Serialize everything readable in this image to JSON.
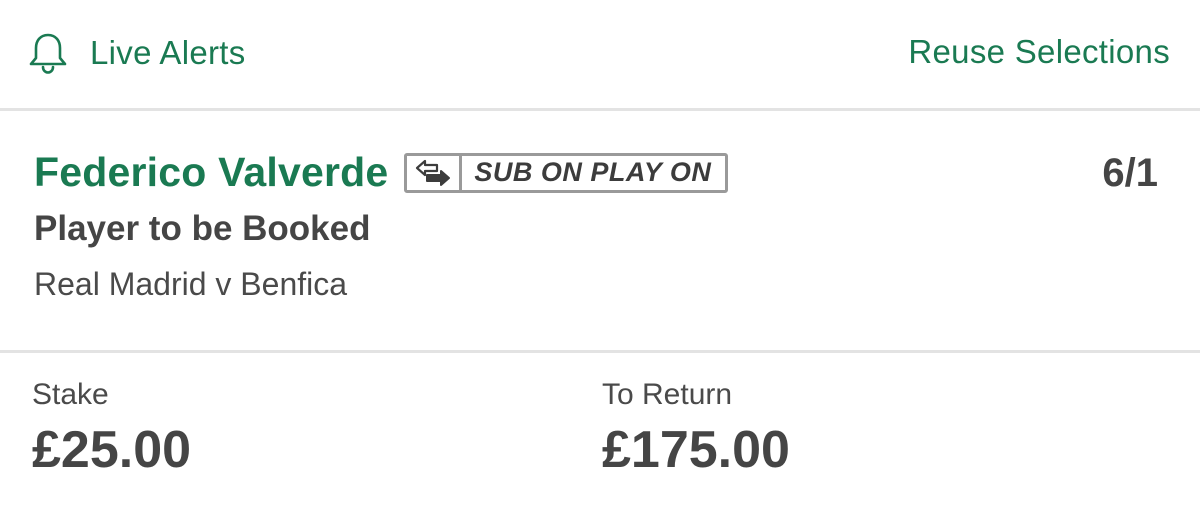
{
  "header": {
    "live_alerts_label": "Live Alerts",
    "reuse_selections_label": "Reuse Selections",
    "bell_icon": "bell-icon"
  },
  "selection": {
    "player_name": "Federico Valverde",
    "badge_label": "SUB ON PLAY ON",
    "badge_icon": "swap-arrows-icon",
    "odds": "6/1",
    "market": "Player to be Booked",
    "event": "Real Madrid v Benfica"
  },
  "bet": {
    "stake_label": "Stake",
    "stake_value": "£25.00",
    "return_label": "To Return",
    "return_value": "£175.00"
  },
  "colors": {
    "accent_green": "#1a7a52",
    "text_dark": "#454545",
    "divider": "#e3e3e3",
    "badge_border": "#9a9a9a"
  }
}
